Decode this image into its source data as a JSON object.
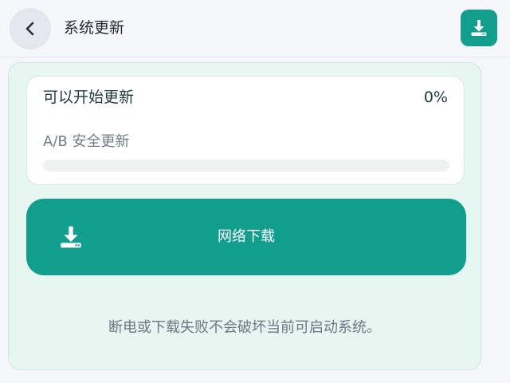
{
  "header": {
    "title": "系统更新",
    "back_icon": "chevron-left-icon",
    "download_icon": "download-icon",
    "accent": "#129e8c"
  },
  "update_card": {
    "title": "可以开始更新",
    "percent_text": "0%",
    "progress": 0,
    "subtitle": "A/B 安全更新"
  },
  "network_download": {
    "label": "网络下载",
    "icon": "download-icon",
    "color": "#119e8c"
  },
  "note": "断电或下载失败不会破坏当前可启动系统。"
}
